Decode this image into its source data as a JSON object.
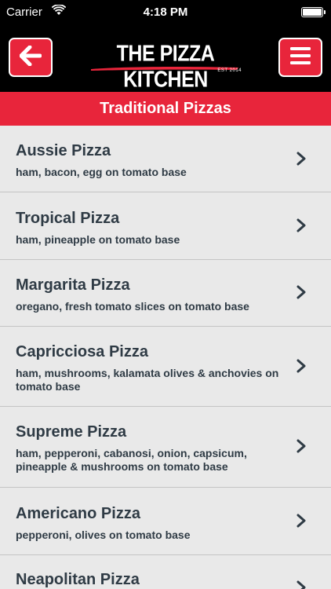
{
  "status_bar": {
    "carrier": "Carrier",
    "time": "4:18 PM"
  },
  "nav": {
    "logo_text": "THE PIZZA KITCHEN",
    "logo_est": "EST 2014",
    "accent_color": "#e8253b"
  },
  "section": {
    "title": "Traditional Pizzas"
  },
  "pizzas": [
    {
      "name": "Aussie Pizza",
      "desc": "ham, bacon, egg on tomato base"
    },
    {
      "name": "Tropical Pizza",
      "desc": "ham, pineapple on tomato base"
    },
    {
      "name": "Margarita Pizza",
      "desc": "oregano, fresh tomato slices on tomato base"
    },
    {
      "name": "Capricciosa Pizza",
      "desc": "ham, mushrooms, kalamata olives & anchovies on tomato base"
    },
    {
      "name": "Supreme Pizza",
      "desc": "ham, pepperoni, cabanosi, onion, capsicum, pineapple & mushrooms on tomato base"
    },
    {
      "name": "Americano Pizza",
      "desc": "pepperoni, olives on tomato base"
    },
    {
      "name": "Neapolitan Pizza",
      "desc": ""
    }
  ]
}
